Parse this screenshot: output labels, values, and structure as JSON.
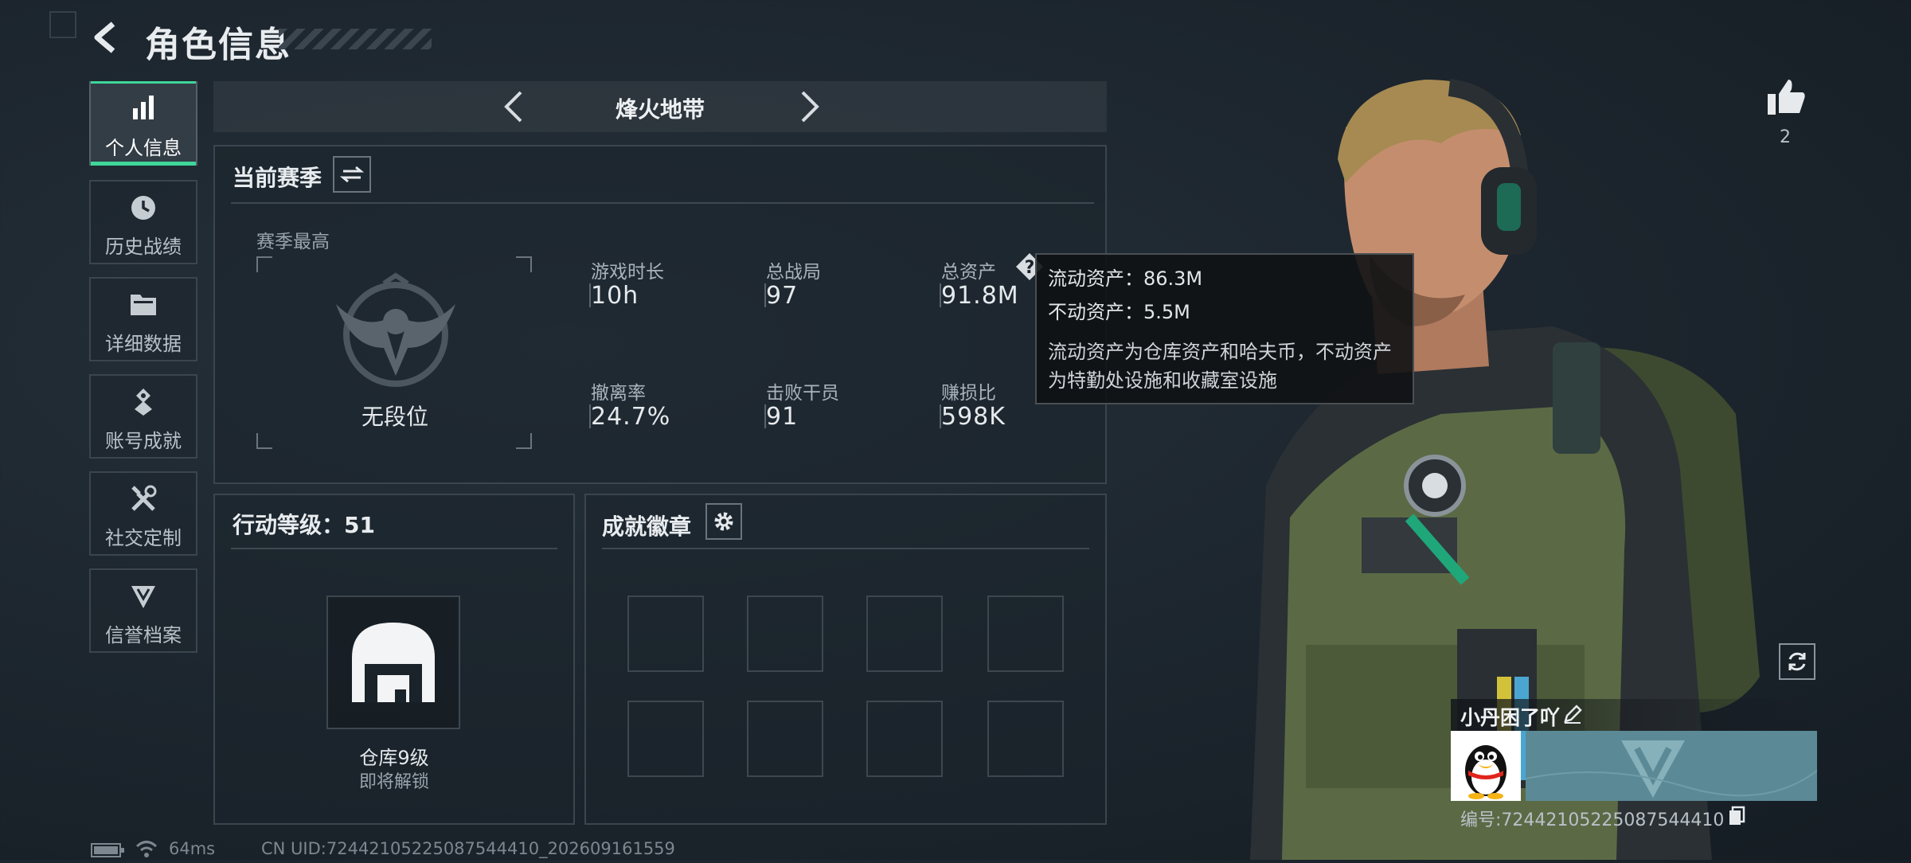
{
  "header": {
    "title": "角色信息"
  },
  "sidebar": {
    "items": [
      {
        "label": "个人信息",
        "icon": "bar-chart-icon",
        "active": true
      },
      {
        "label": "历史战绩",
        "icon": "clock-icon"
      },
      {
        "label": "详细数据",
        "icon": "folder-icon"
      },
      {
        "label": "账号成就",
        "icon": "medal-icon"
      },
      {
        "label": "社交定制",
        "icon": "tools-icon"
      },
      {
        "label": "信誉档案",
        "icon": "shield-badge-icon"
      }
    ]
  },
  "mode": {
    "label": "烽火地带"
  },
  "season": {
    "title": "当前赛季",
    "best_label": "赛季最高",
    "rank": "无段位",
    "stats": [
      {
        "label": "游戏时长",
        "value": "10h"
      },
      {
        "label": "总战局",
        "value": "97"
      },
      {
        "label": "总资产",
        "value": "91.8M"
      },
      {
        "label": "撤离率",
        "value": "24.7%"
      },
      {
        "label": "击败干员",
        "value": "91"
      },
      {
        "label": "赚损比",
        "value": "598K"
      }
    ]
  },
  "tooltip": {
    "liquid": "流动资产：86.3M",
    "fixed": "不动资产：5.5M",
    "desc1": "流动资产为仓库资产和哈夫币，不动资产",
    "desc2": "为特勤处设施和收藏室设施"
  },
  "action_level": {
    "title": "行动等级：51",
    "unlock_name": "仓库9级",
    "unlock_status": "即将解锁"
  },
  "achievements": {
    "title": "成就徽章"
  },
  "profile": {
    "likes": "2",
    "nickname": "小丹困了吖",
    "id_text": "编号:724421052250875444​10"
  },
  "status_bar": {
    "ping": "64ms",
    "uid": "CN UID:7244210522508754​4410_202609161559"
  },
  "colors": {
    "accent": "#3fd69a",
    "banner": "#5b8a96"
  }
}
